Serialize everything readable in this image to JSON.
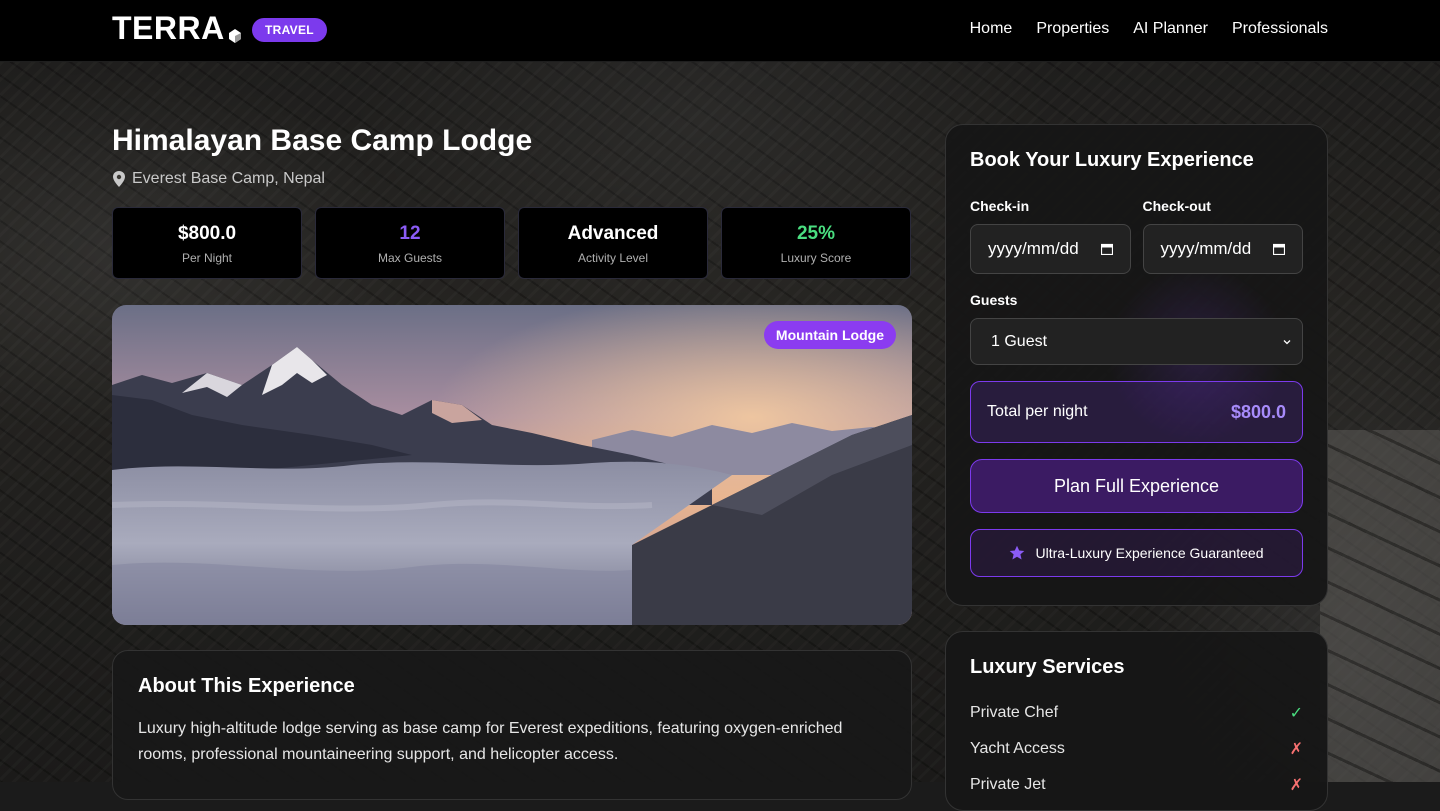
{
  "nav": {
    "logo": "TERRA",
    "badge": "TRAVEL",
    "links": [
      "Home",
      "Properties",
      "AI Planner",
      "Professionals"
    ]
  },
  "property": {
    "title": "Himalayan Base Camp Lodge",
    "location": "Everest Base Camp, Nepal",
    "stats": [
      {
        "value": "$800.0",
        "label": "Per Night",
        "color": "#ffffff"
      },
      {
        "value": "12",
        "label": "Max Guests",
        "color": "#8b5cf6"
      },
      {
        "value": "Advanced",
        "label": "Activity Level",
        "color": "#ffffff"
      },
      {
        "value": "25%",
        "label": "Luxury Score",
        "color": "#4ade80"
      }
    ],
    "image_badge": "Mountain Lodge",
    "about_title": "About This Experience",
    "about_text": "Luxury high-altitude lodge serving as base camp for Everest expeditions, featuring oxygen-enriched rooms, professional mountaineering support, and helicopter access."
  },
  "booking": {
    "title": "Book Your Luxury Experience",
    "checkin_label": "Check-in",
    "checkin_value": "yyyy/mm/dd",
    "checkout_label": "Check-out",
    "checkout_value": "yyyy/mm/dd",
    "guests_label": "Guests",
    "guests_value": "1 Guest",
    "total_label": "Total per night",
    "total_value": "$800.0",
    "plan_button": "Plan Full Experience",
    "guarantee": "Ultra-Luxury Experience Guaranteed",
    "accent": "#7c3aed"
  },
  "services": {
    "title": "Luxury Services",
    "items": [
      {
        "name": "Private Chef",
        "available": true,
        "mark": "✓"
      },
      {
        "name": "Yacht Access",
        "available": false,
        "mark": "✗"
      },
      {
        "name": "Private Jet",
        "available": false,
        "mark": "✗"
      }
    ]
  }
}
